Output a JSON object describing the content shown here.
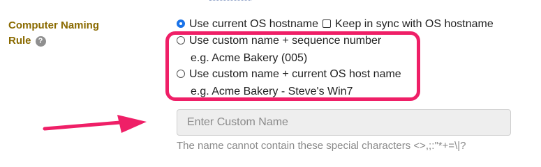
{
  "field": {
    "label_line1": "Computer Naming",
    "label_line2": "Rule",
    "help_glyph": "?"
  },
  "options": [
    {
      "label": "Use current OS hostname",
      "selected": true
    },
    {
      "label": "Use custom name + sequence number",
      "selected": false,
      "example": "e.g. Acme Bakery (005)"
    },
    {
      "label": "Use custom name + current OS host name",
      "selected": false,
      "example": "e.g. Acme Bakery - Steve's Win7"
    }
  ],
  "keep_in_sync": {
    "label": "Keep in sync with OS hostname",
    "checked": false
  },
  "custom_name": {
    "placeholder": "Enter Custom Name",
    "value": ""
  },
  "hint": "The name cannot contain these special characters <>,;:\"*+=\\|?",
  "colors": {
    "label": "#8a6a00",
    "highlight": "#ef1f67",
    "radio_selected": "#1a73e8"
  },
  "icons": {
    "help": "question-circle-icon",
    "annotation": "arrow-right-icon"
  }
}
